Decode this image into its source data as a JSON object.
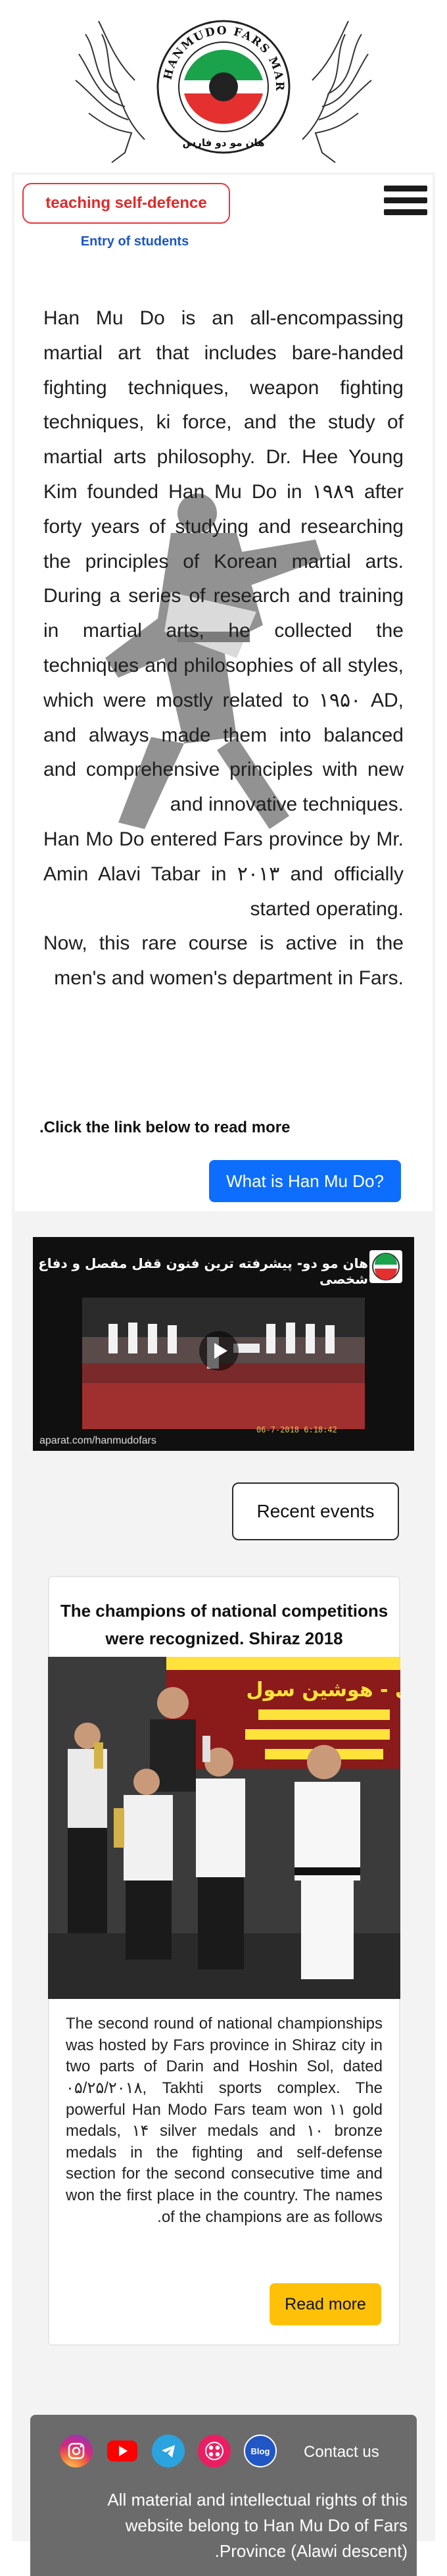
{
  "logo": {
    "ring_text": "HANMUDO FARS MARTIAL ARTS",
    "persian_text": "هان مو دو فارس"
  },
  "nav": {
    "teach_button": "teaching self-defence",
    "entry_link": "Entry of students"
  },
  "intro": {
    "paragraphs": [
      "Han Mu Do is an all-encompassing martial art that includes bare-handed fighting techniques, weapon fighting techniques, ki force, and the study of martial arts philosophy. Dr. Hee Young Kim founded Han Mu Do in ۱۹۸۹ after forty years of studying and researching the principles of Korean martial arts. During a series of research and training in martial arts, he collected the techniques and philosophies of all styles, which were mostly related to ۱۹۵۰ AD, and always made them into balanced and comprehensive principles with new and innovative techniques.",
      "Han Mo Do entered Fars province by Mr. Amin Alavi Tabar in ۲۰۱۳ and officially started operating.",
      "Now, this rare course is active in the men's and women's department in Fars."
    ],
    "read_more_note": "Click the link below to read more.",
    "what_is_button": "What is Han Mu Do?"
  },
  "video": {
    "title": "هان مو دو- پیشرفته ترین فنون قفل مفصل و دفاع شخصی",
    "brand": "aparat.com/hanmudofars",
    "stamp": "06-7-2018  6:18:42"
  },
  "recent": {
    "button": "Recent events"
  },
  "event": {
    "title": "The champions of national competitions were recognized. Shiraz 2018",
    "banner_text": "داری - هوشین سول",
    "body": "The second round of national championships was hosted by Fars province in Shiraz city in two parts of Darin and Hoshin Sol, dated ۰۵/۲۵/۲۰۱۸, Takhti sports complex. The powerful Han Modo Fars team won ۱۱ gold medals, ۱۴ silver medals and ۱۰ bronze medals in the fighting and self-defense section for the second consecutive time and won the first place in the country. The names of the champions are as follows.",
    "button": "Read more"
  },
  "footer": {
    "contact": "Contact us",
    "blog_label": "Blog",
    "rights": "All material and intellectual rights of this website belong to Han Mu Do of Fars Province (Alawi descent)."
  },
  "colors": {
    "accent_red": "#e02a2a",
    "link_blue": "#1a55c8",
    "primary_blue": "#0d6efd",
    "warning_yellow": "#ffc107",
    "footer_gray": "#6b6b6b"
  },
  "icons": [
    "menu-icon",
    "instagram-icon",
    "youtube-icon",
    "telegram-icon",
    "aparat-icon",
    "blog-icon",
    "play-icon"
  ]
}
